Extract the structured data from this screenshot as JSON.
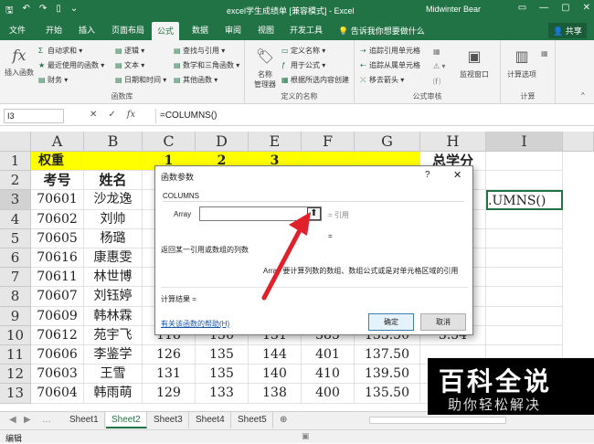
{
  "window": {
    "title": "excel学生成绩单 [兼容模式] - Excel",
    "user": "Midwinter Bear",
    "share": "共享",
    "tell_me": "告诉我你想要做什么"
  },
  "tabs": [
    "文件",
    "开始",
    "插入",
    "页面布局",
    "公式",
    "数据",
    "审阅",
    "视图",
    "开发工具"
  ],
  "active_tab": "公式",
  "ribbon": {
    "insert_function": "插入函数",
    "autosum": "自动求和",
    "recent": "最近使用的函数",
    "financial": "财务",
    "logical": "逻辑",
    "text": "文本",
    "datetime": "日期和时间",
    "lookup": "查找与引用",
    "math": "数学和三角函数",
    "other": "其他函数",
    "group_library": "函数库",
    "name_manager": "名称\n管理器",
    "define_name": "定义名称",
    "use_in_formula": "用于公式",
    "create_from_sel": "根据所选内容创建",
    "group_names": "定义的名称",
    "trace_precedents": "追踪引用单元格",
    "trace_dependents": "追踪从属单元格",
    "remove_arrows": "移去箭头",
    "group_audit": "公式审核",
    "watch_window": "监视窗口",
    "calc_options": "计算选项",
    "group_calc": "计算"
  },
  "formula_bar": {
    "name_box": "I3",
    "cancel": "✕",
    "enter": "✓",
    "fx": "fx",
    "formula": "=COLUMNS()"
  },
  "columns": [
    "A",
    "B",
    "C",
    "D",
    "E",
    "F",
    "G",
    "H",
    "I"
  ],
  "rows": [
    [
      "权重",
      "",
      "1",
      "2",
      "3",
      "",
      "",
      "总学分",
      ""
    ],
    [
      "考号",
      "姓名",
      "",
      "",
      "",
      "",
      "",
      "",
      ""
    ],
    [
      "70601",
      "沙龙逸",
      "",
      "",
      "",
      "",
      "",
      "",
      ".UMNS()"
    ],
    [
      "70602",
      "刘帅",
      "",
      "",
      "",
      "",
      "",
      "",
      ""
    ],
    [
      "70605",
      "杨璐",
      "",
      "",
      "",
      "",
      "",
      "",
      ""
    ],
    [
      "70616",
      "康惠雯",
      "",
      "",
      "",
      "",
      "",
      "",
      ""
    ],
    [
      "70611",
      "林世博",
      "",
      "",
      "",
      "",
      "",
      "",
      ""
    ],
    [
      "70607",
      "刘钰婷",
      "",
      "",
      "",
      "",
      "",
      "",
      ""
    ],
    [
      "70609",
      "韩林霖",
      "",
      "",
      "",
      "",
      "",
      "",
      ""
    ],
    [
      "70612",
      "苑宇飞",
      "118",
      "136",
      "131",
      "385",
      "133.50",
      "3.54",
      ""
    ],
    [
      "70606",
      "李鉴学",
      "126",
      "135",
      "144",
      "401",
      "137.50",
      "",
      ""
    ],
    [
      "70603",
      "王雪",
      "131",
      "135",
      "140",
      "410",
      "139.50",
      "",
      ""
    ],
    [
      "70604",
      "韩雨萌",
      "129",
      "133",
      "138",
      "400",
      "135.50",
      "",
      ""
    ]
  ],
  "row_numbers": [
    "1",
    "2",
    "3",
    "4",
    "5",
    "6",
    "7",
    "8",
    "9",
    "10",
    "11",
    "12",
    "13"
  ],
  "sheets": [
    "Sheet1",
    "Sheet2",
    "Sheet3",
    "Sheet4",
    "Sheet5"
  ],
  "active_sheet": "Sheet2",
  "status": {
    "mode": "编辑"
  },
  "dialog": {
    "title": "函数参数",
    "help_q": "?",
    "close": "✕",
    "function_name": "COLUMNS",
    "arg_label": "Array",
    "arg_result": "= 引用",
    "eq": "=",
    "description": "返回某一引用或数组的列数",
    "arg_description": "Array  要计算列数的数组、数组公式或是对单元格区域的引用",
    "calc_result": "计算结果 =",
    "help_link": "有关该函数的帮助(H)",
    "ok": "确定",
    "cancel": "取消"
  },
  "watermark": {
    "line1": "百科全说",
    "line2": "助你轻松解决"
  },
  "colors": {
    "excel_green": "#217346",
    "header_yellow": "#ffff00",
    "arrow_red": "#e0202a"
  }
}
